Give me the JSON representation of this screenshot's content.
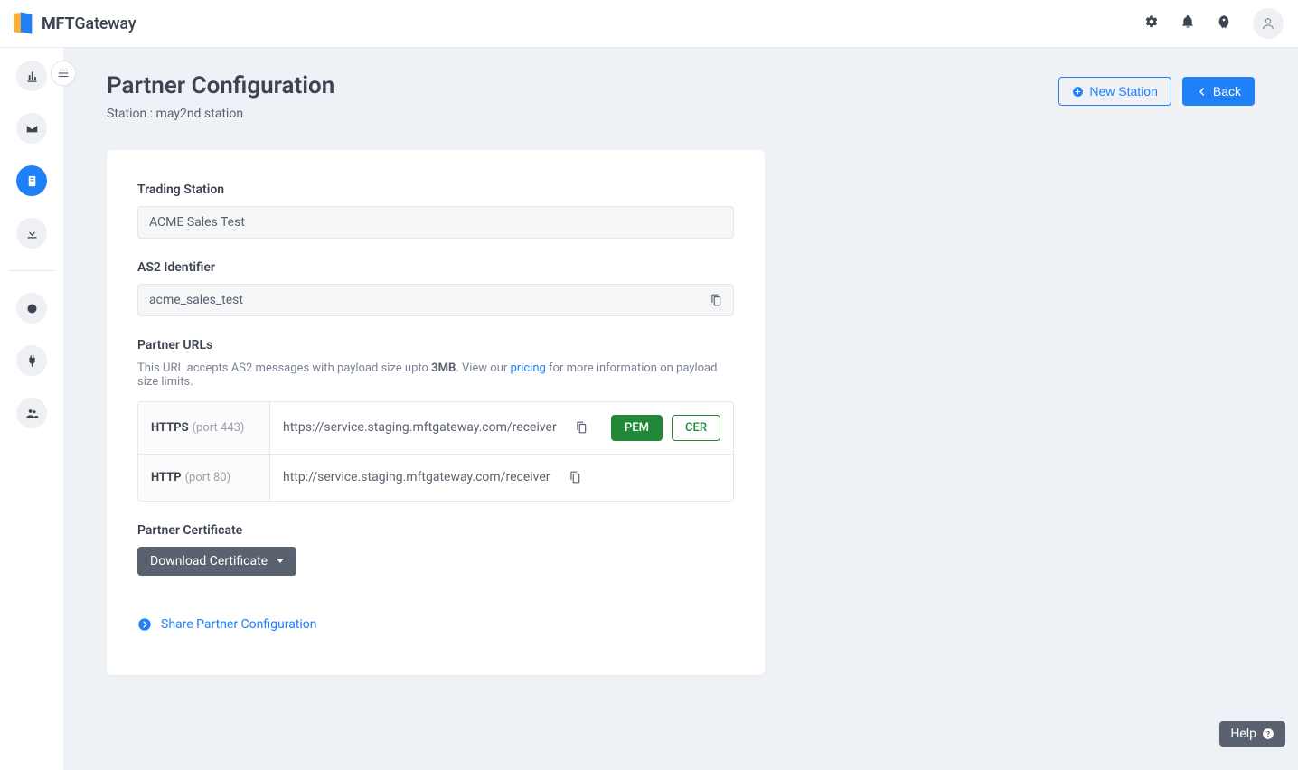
{
  "logo_text_bold": "MFT",
  "logo_text_rest": "Gateway",
  "topnav": {
    "icons": [
      "gear",
      "bell",
      "rocket",
      "user"
    ]
  },
  "page": {
    "title": "Partner Configuration",
    "subtitle_prefix": "Station : ",
    "subtitle_value": "may2nd station"
  },
  "actions": {
    "new_station": "New Station",
    "back": "Back"
  },
  "form": {
    "trading_station_label": "Trading Station",
    "trading_station_value": "ACME Sales Test",
    "as2_label": "AS2 Identifier",
    "as2_value": "acme_sales_test",
    "urls_label": "Partner URLs",
    "urls_help_before": "This URL accepts AS2 messages with payload size upto ",
    "urls_help_bold": "3MB",
    "urls_help_mid": ". View our ",
    "urls_help_link": "pricing",
    "urls_help_after": " for more information on payload size limits.",
    "rows": [
      {
        "proto": "HTTPS",
        "port": "(port 443)",
        "url": "https://service.staging.mftgateway.com/receiver",
        "pem": "PEM",
        "cer": "CER"
      },
      {
        "proto": "HTTP",
        "port": "(port 80)",
        "url": "http://service.staging.mftgateway.com/receiver"
      }
    ],
    "cert_label": "Partner Certificate",
    "download_btn": "Download Certificate",
    "share_link": "Share Partner Configuration"
  },
  "help": "Help"
}
